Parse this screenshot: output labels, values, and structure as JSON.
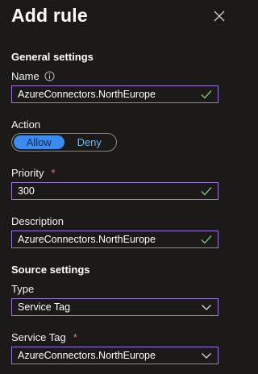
{
  "header": {
    "title": "Add rule"
  },
  "general": {
    "section_title": "General settings",
    "name": {
      "label": "Name",
      "value": "AzureConnectors.NorthEurope"
    },
    "action": {
      "label": "Action",
      "options": [
        "Allow",
        "Deny"
      ],
      "selected": "Allow"
    },
    "priority": {
      "label": "Priority",
      "required_mark": "*",
      "value": "300"
    },
    "description": {
      "label": "Description",
      "value": "AzureConnectors.NorthEurope"
    }
  },
  "source": {
    "section_title": "Source settings",
    "type": {
      "label": "Type",
      "value": "Service Tag"
    },
    "service_tag": {
      "label": "Service Tag",
      "required_mark": "*",
      "value": "AzureConnectors.NorthEurope"
    }
  },
  "colors": {
    "background": "#1b1a19",
    "field_border": "#9a7ad6",
    "valid_check": "#7cc27a",
    "toggle_selected": "#3a8cf0",
    "toggle_unselected_text": "#6cb8f6",
    "required": "#f1707b"
  }
}
